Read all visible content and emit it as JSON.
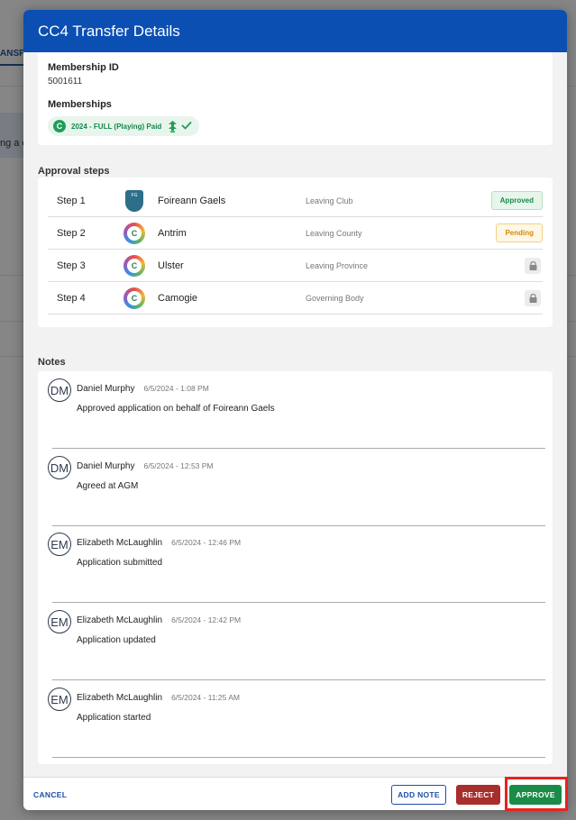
{
  "background": {
    "tab_fragment": "ANSF",
    "info_fragment": "ng a c"
  },
  "modal": {
    "title": "CC4 Transfer Details"
  },
  "membership": {
    "id_label": "Membership ID",
    "id_value": "5001611",
    "memberships_label": "Memberships",
    "chip_text": "2024 - FULL (Playing) Paid"
  },
  "approval": {
    "title": "Approval steps",
    "steps": [
      {
        "step": "Step 1",
        "name": "Foireann Gaels",
        "type": "Leaving Club",
        "status": "Approved",
        "logo": "club-crest-icon"
      },
      {
        "step": "Step 2",
        "name": "Antrim",
        "type": "Leaving County",
        "status": "Pending",
        "logo": "camogie-logo-icon"
      },
      {
        "step": "Step 3",
        "name": "Ulster",
        "type": "Leaving Province",
        "status": "",
        "logo": "camogie-logo-icon"
      },
      {
        "step": "Step 4",
        "name": "Camogie",
        "type": "Governing Body",
        "status": "",
        "logo": "camogie-logo-icon"
      }
    ]
  },
  "notes": {
    "title": "Notes",
    "items": [
      {
        "initials": "DM",
        "author": "Daniel Murphy",
        "time": "6/5/2024 - 1:08 PM",
        "text": "Approved application on behalf of Foireann Gaels"
      },
      {
        "initials": "DM",
        "author": "Daniel Murphy",
        "time": "6/5/2024 - 12:53 PM",
        "text": "Agreed at AGM"
      },
      {
        "initials": "EM",
        "author": "Elizabeth McLaughlin",
        "time": "6/5/2024 - 12:46 PM",
        "text": "Application submitted"
      },
      {
        "initials": "EM",
        "author": "Elizabeth McLaughlin",
        "time": "6/5/2024 - 12:42 PM",
        "text": "Application updated"
      },
      {
        "initials": "EM",
        "author": "Elizabeth McLaughlin",
        "time": "6/5/2024 - 11:25 AM",
        "text": "Application started"
      }
    ]
  },
  "footer": {
    "cancel": "CANCEL",
    "add_note": "ADD NOTE",
    "reject": "REJECT",
    "approve": "APPROVE"
  },
  "colors": {
    "header": "#0b4fb3",
    "approve": "#1b8c48",
    "reject": "#a82d2d",
    "highlight": "#e8231d"
  }
}
